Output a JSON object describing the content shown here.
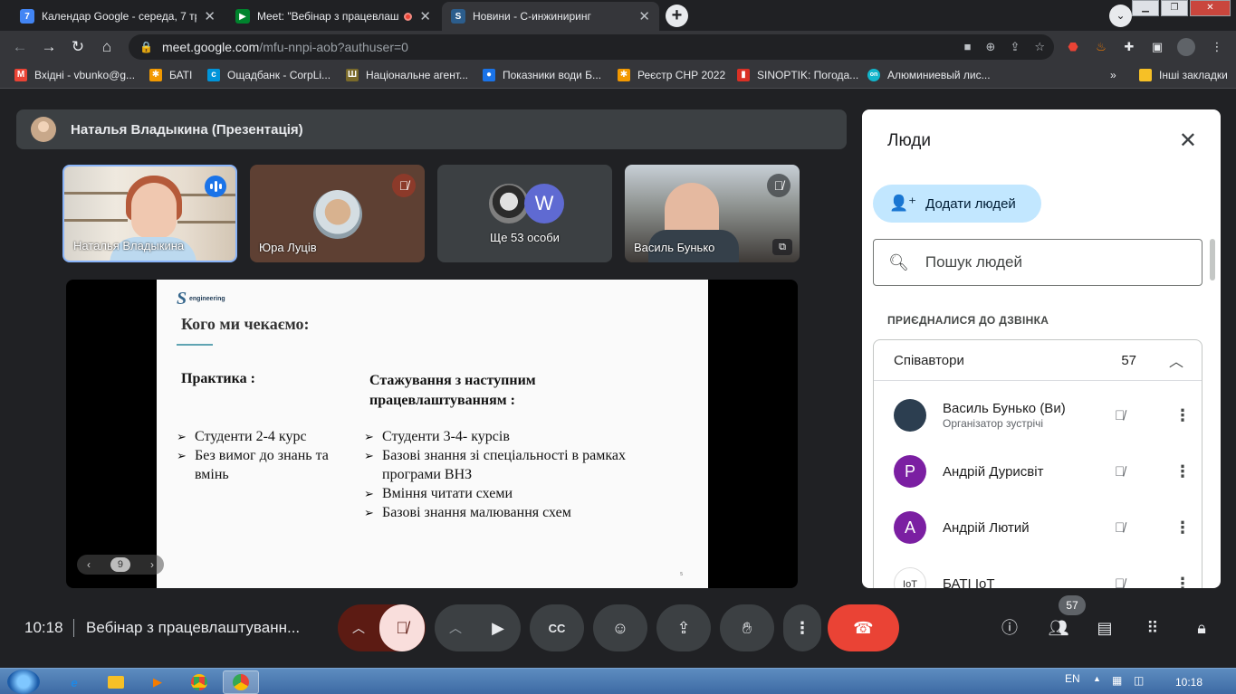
{
  "browser": {
    "tabs": [
      {
        "title": "Календар Google - середа, 7 тра",
        "favicon": "google-calendar-icon",
        "fav_color": "#4285f4",
        "fav_text": "7"
      },
      {
        "title": "Meet: \"Вебінар з працевлаш",
        "favicon": "google-meet-icon",
        "fav_color": "#00832d",
        "fav_text": "▶"
      },
      {
        "title": "Новини - С-инжиниринг",
        "favicon": "s-engineering-icon",
        "fav_color": "#2c5d8c",
        "fav_text": "S"
      }
    ],
    "url_host": "meet.google.com",
    "url_path": "/mfu-nnpi-aob?authuser=0",
    "bookmarks": [
      {
        "label": "Вхідні - vbunko@g...",
        "icon": "gmail-icon",
        "color": "#ea4335",
        "glyph": "M"
      },
      {
        "label": "БАТІ",
        "icon": "bati-icon",
        "color": "#f29900",
        "glyph": "✱"
      },
      {
        "label": "Ощадбанк - CorpLi...",
        "icon": "oschadbank-icon",
        "color": "#0094d9",
        "glyph": "c"
      },
      {
        "label": "Національне агент...",
        "icon": "trident-icon",
        "color": "#7a6a2a",
        "glyph": "Ш"
      },
      {
        "label": "Показники води Б...",
        "icon": "water-drop-icon",
        "color": "#1a73e8",
        "glyph": "●"
      },
      {
        "label": "Реєстр СНР 2022",
        "icon": "registry-icon",
        "color": "#f29900",
        "glyph": "✱"
      },
      {
        "label": "SINOPTIK: Погода...",
        "icon": "sinoptik-icon",
        "color": "#d93025",
        "glyph": "▮"
      },
      {
        "label": "Алюминиевый лис...",
        "icon": "aluminium-icon",
        "color": "#12b5cb",
        "glyph": "on"
      }
    ],
    "other_bookmarks": "Інші закладки"
  },
  "meet": {
    "presenter_label": "Наталья Владыкина (Презентація)",
    "tiles": [
      {
        "name": "Наталья Владыкина"
      },
      {
        "name": "Юра Луців"
      },
      {
        "name": "Ще 53 особи",
        "avatar_letter": "W"
      },
      {
        "name": "Василь Бунько"
      }
    ],
    "slide": {
      "logo_letter": "S",
      "logo_text": "engineering",
      "title": "Кого ми чекаємо:",
      "col1_heading": "Практика :",
      "col1_items": [
        "Студенти  2-4 курс",
        "Без вимог до знань та вмінь"
      ],
      "col2_heading": "Стажування з наступним працевлаштуванням :",
      "col2_items": [
        "Студенти  3-4- курсів",
        "Базові знання зі спеціальності в рамках програми ВНЗ",
        "Вміння читати схеми",
        "Базові знання малювання схем"
      ],
      "footer_number": "5",
      "page_number": "9"
    },
    "time": "10:18",
    "meeting_title": "Вебінар з працевлаштуванн...",
    "participants_count": "57",
    "accent_red": "#ea4335"
  },
  "people_panel": {
    "title": "Люди",
    "add_people": "Додати людей",
    "search_placeholder": "Пошук людей",
    "section_label": "ПРИЄДНАЛИСЯ ДО ДЗВІНКА",
    "group_label": "Співавтори",
    "group_count": "57",
    "people": [
      {
        "name": "Василь Бунько (Ви)",
        "sub": "Організатор зустрічі",
        "avatar": "photo",
        "color": "#2c3e50"
      },
      {
        "name": "Андрій Дурисвіт",
        "sub": "",
        "avatar": "P",
        "color": "#7b1fa2"
      },
      {
        "name": "Андрій Лютий",
        "sub": "",
        "avatar": "A",
        "color": "#7b1fa2"
      },
      {
        "name": "БАТІ IoT",
        "sub": "",
        "avatar": "iot",
        "color": "#ffffff"
      }
    ]
  },
  "taskbar": {
    "lang": "EN",
    "time": "10:18"
  }
}
